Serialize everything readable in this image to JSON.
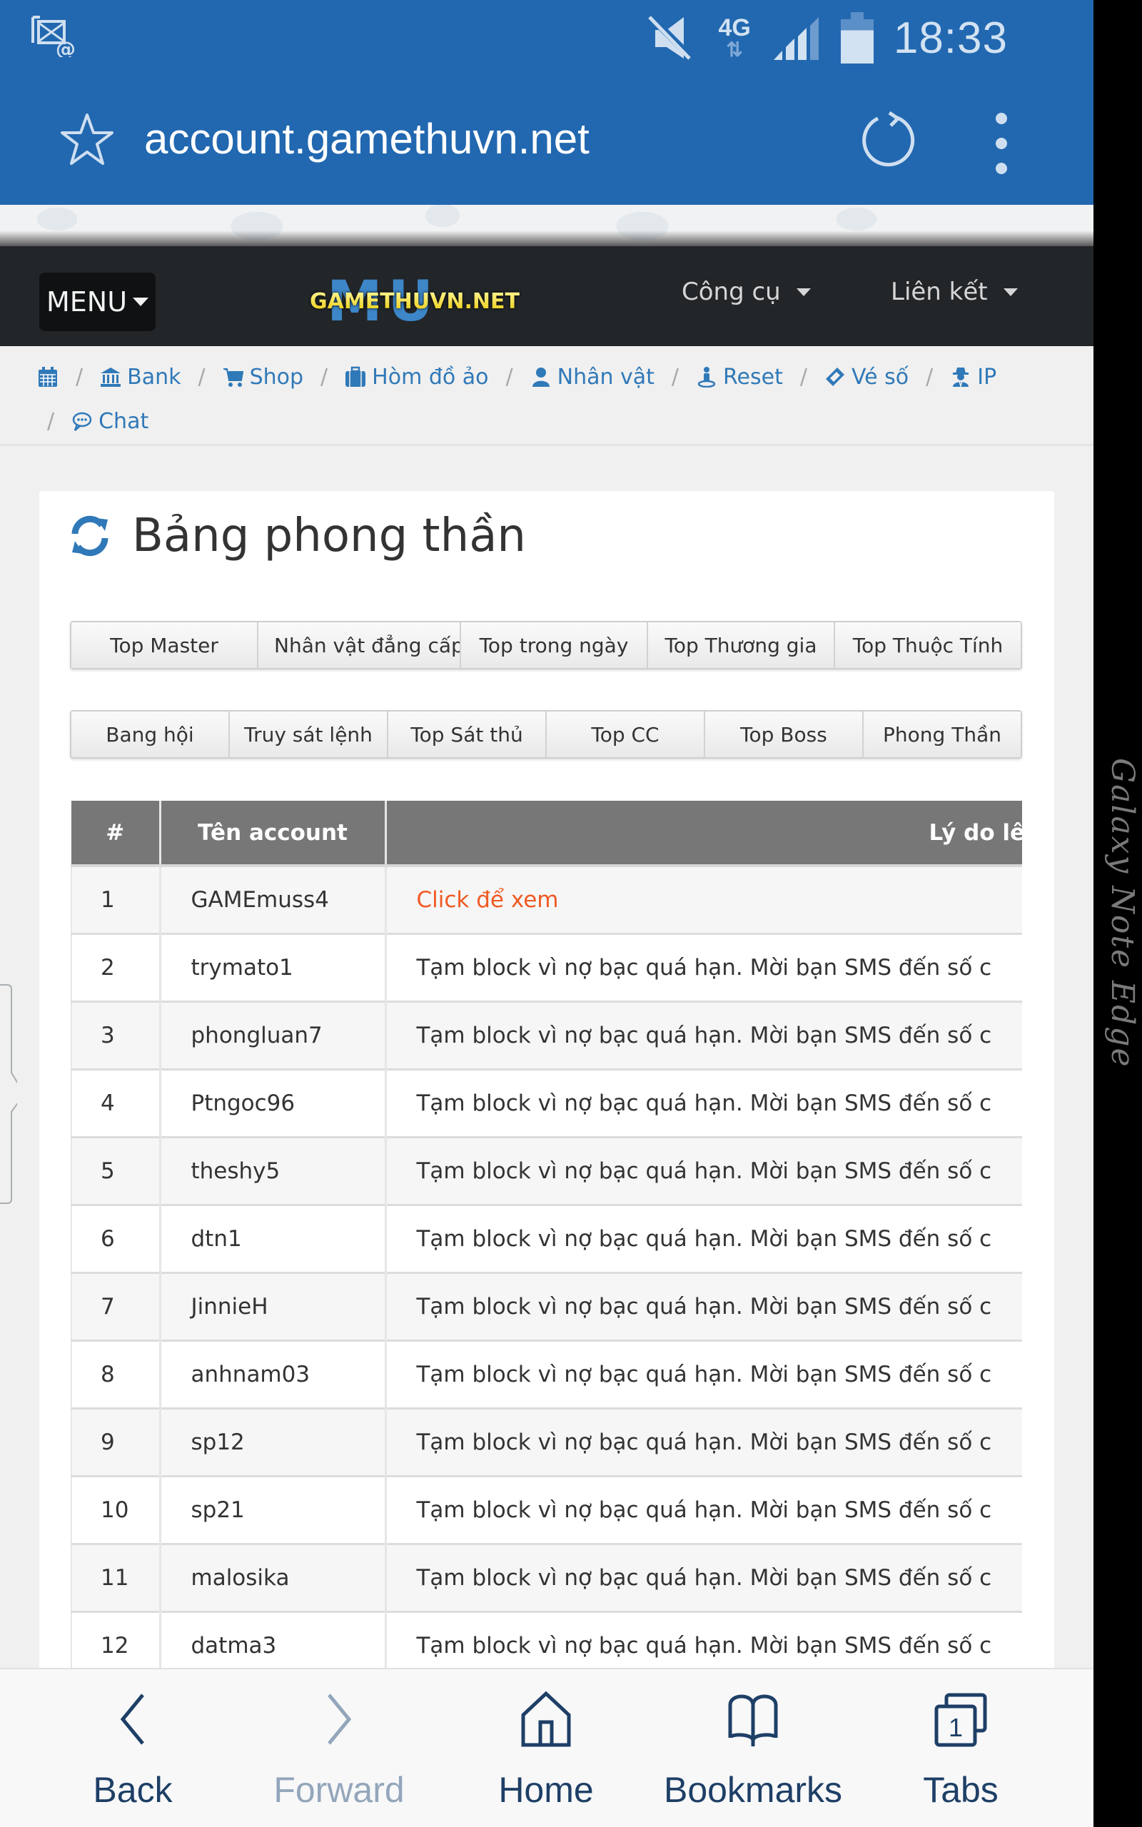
{
  "status_bar": {
    "time": "18:33",
    "network": "4G",
    "network_arrows": "⇅",
    "signal_bars_lit": 3,
    "signal_bars_total": 4,
    "battery_level": 0.75,
    "icons": [
      "email-notification-icon",
      "mute-icon",
      "network-4g-icon",
      "signal-icon",
      "battery-icon"
    ]
  },
  "browser": {
    "url": "account.gamethuvn.net",
    "icons": [
      "bookmark-star-icon",
      "reload-icon",
      "more-menu-icon"
    ]
  },
  "navbar": {
    "menu_label": "MENU",
    "logo": {
      "mu": "MU",
      "text": "GAMETHUVN.NET"
    },
    "dropdowns": [
      {
        "label": "Công cụ"
      },
      {
        "label": "Liên kết"
      }
    ]
  },
  "breadcrumb": {
    "separator": "/",
    "items": [
      {
        "icon": "calendar-icon",
        "label": ""
      },
      {
        "icon": "bank-icon",
        "label": "Bank"
      },
      {
        "icon": "shopping-cart-icon",
        "label": "Shop"
      },
      {
        "icon": "suitcase-icon",
        "label": "Hòm đồ ảo"
      },
      {
        "icon": "user-icon",
        "label": "Nhân vật"
      },
      {
        "icon": "reset-user-icon",
        "label": "Reset"
      },
      {
        "icon": "ticket-icon",
        "label": "Vé số"
      },
      {
        "icon": "user-secret-icon",
        "label": "IP"
      },
      {
        "icon": "chat-icon",
        "label": "Chat"
      }
    ]
  },
  "page": {
    "title": "Bảng phong thần",
    "title_icon": "refresh-icon",
    "tabs_row1": [
      "Top Master",
      "Nhân vật đẳng cấp",
      "Top trong ngày",
      "Top Thương gia",
      "Top Thuộc Tính"
    ],
    "tabs_row2": [
      "Bang hội",
      "Truy sát lệnh",
      "Top Sát thủ",
      "Top CC",
      "Top Boss",
      "Phong Thần"
    ]
  },
  "table": {
    "headers": [
      "#",
      "Tên account",
      "Lý do lên"
    ],
    "rows": [
      {
        "num": "1",
        "account": "GAMEmuss4",
        "reason": "Click để xem",
        "is_link": true
      },
      {
        "num": "2",
        "account": "trymato1",
        "reason": "Tạm block vì nợ bạc quá hạn. Mời bạn SMS đến số c"
      },
      {
        "num": "3",
        "account": "phongluan7",
        "reason": "Tạm block vì nợ bạc quá hạn. Mời bạn SMS đến số c"
      },
      {
        "num": "4",
        "account": "Ptngoc96",
        "reason": "Tạm block vì nợ bạc quá hạn. Mời bạn SMS đến số c"
      },
      {
        "num": "5",
        "account": "theshy5",
        "reason": "Tạm block vì nợ bạc quá hạn. Mời bạn SMS đến số c"
      },
      {
        "num": "6",
        "account": "dtn1",
        "reason": "Tạm block vì nợ bạc quá hạn. Mời bạn SMS đến số c"
      },
      {
        "num": "7",
        "account": "JinnieH",
        "reason": "Tạm block vì nợ bạc quá hạn. Mời bạn SMS đến số c"
      },
      {
        "num": "8",
        "account": "anhnam03",
        "reason": "Tạm block vì nợ bạc quá hạn. Mời bạn SMS đến số c"
      },
      {
        "num": "9",
        "account": "sp12",
        "reason": "Tạm block vì nợ bạc quá hạn. Mời bạn SMS đến số c"
      },
      {
        "num": "10",
        "account": "sp21",
        "reason": "Tạm block vì nợ bạc quá hạn. Mời bạn SMS đến số c"
      },
      {
        "num": "11",
        "account": "malosika",
        "reason": "Tạm block vì nợ bạc quá hạn. Mời bạn SMS đến số c"
      },
      {
        "num": "12",
        "account": "datma3",
        "reason": "Tạm block vì nợ bạc quá hạn. Mời bạn SMS đến số c"
      }
    ]
  },
  "bottom_bar": {
    "items": [
      {
        "label": "Back",
        "icon": "back-chevron-icon",
        "enabled": true
      },
      {
        "label": "Forward",
        "icon": "forward-chevron-icon",
        "enabled": false
      },
      {
        "label": "Home",
        "icon": "home-icon",
        "enabled": true
      },
      {
        "label": "Bookmarks",
        "icon": "bookmarks-icon",
        "enabled": true
      },
      {
        "label": "Tabs",
        "icon": "tabs-icon",
        "enabled": true,
        "count": "1"
      }
    ]
  },
  "device": {
    "edge_label": "Galaxy Note Edge"
  },
  "colors": {
    "browser_blue": "#2268b0",
    "navbar_dark": "#222629",
    "link_blue": "#3079b8",
    "table_header": "#777777",
    "accent_orange": "#f05a23",
    "bottom_icon": "#1e3f66"
  }
}
